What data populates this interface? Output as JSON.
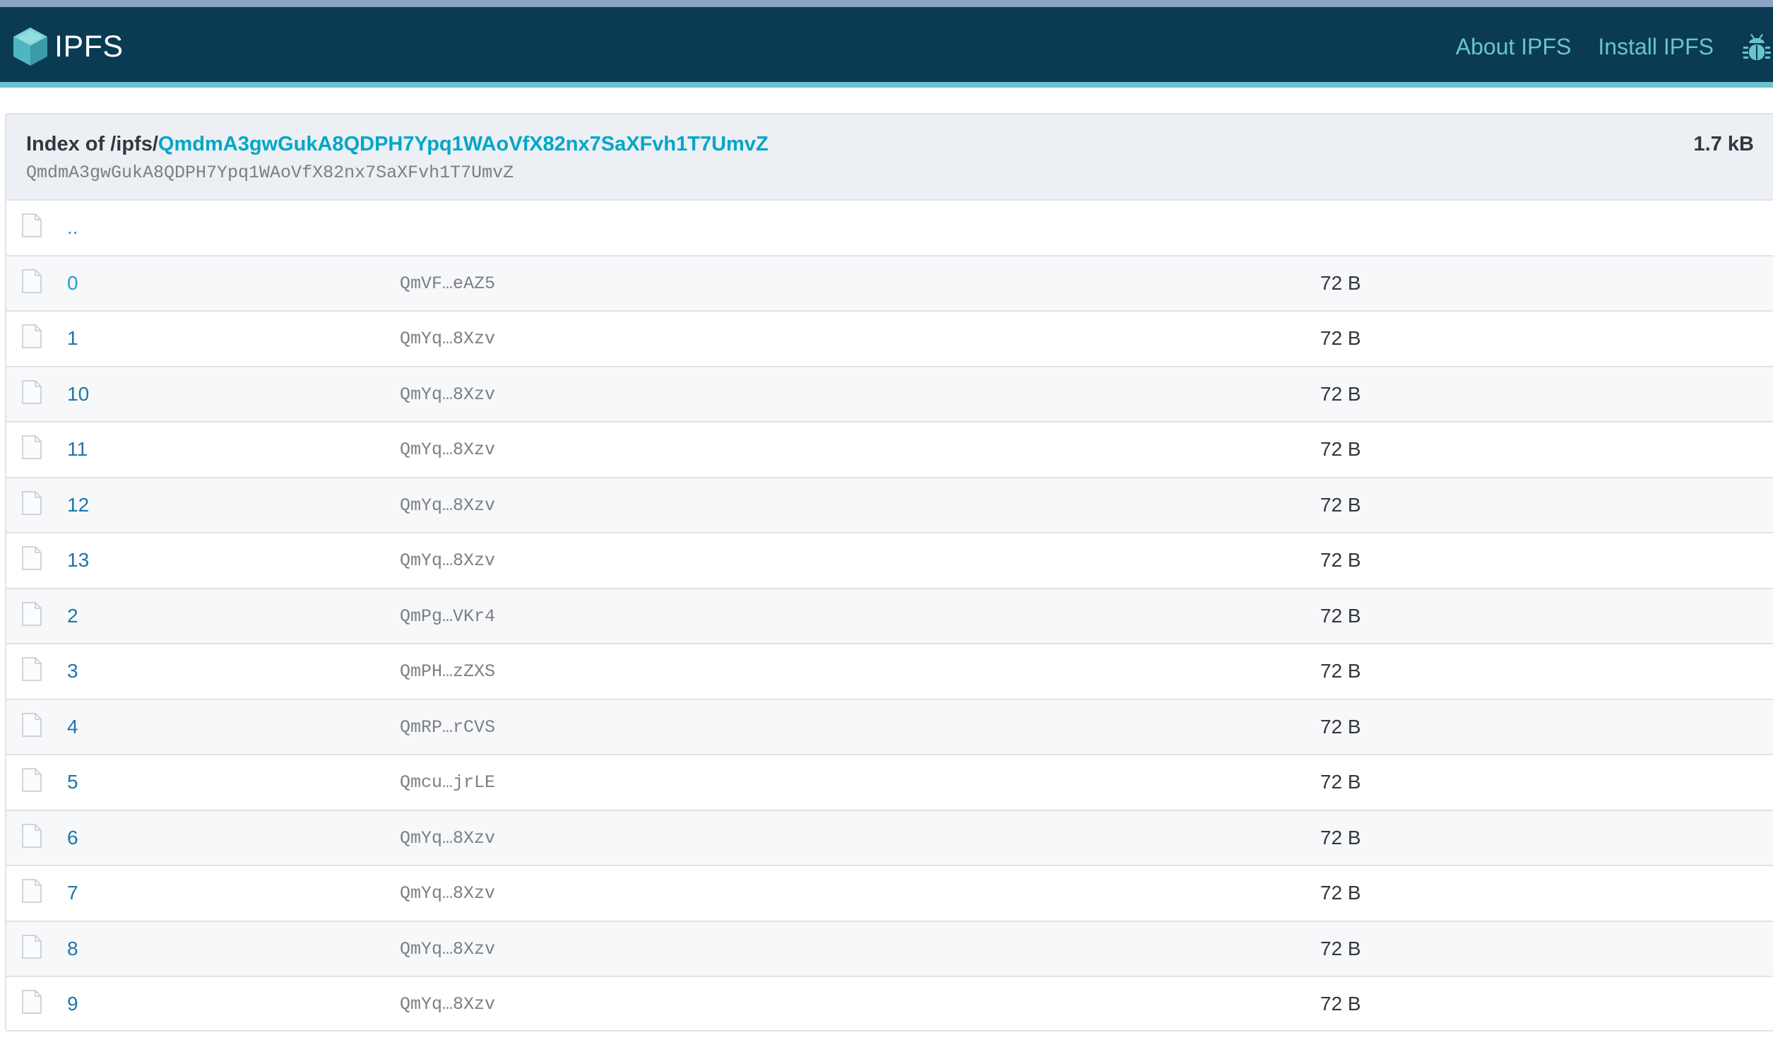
{
  "header": {
    "logo_text": "IPFS",
    "nav": [
      {
        "label": "About IPFS"
      },
      {
        "label": "Install IPFS"
      }
    ],
    "colors": {
      "bar": "#0b3a53",
      "accent": "#69c4cd"
    }
  },
  "listing": {
    "index_prefix": "Index of /ipfs/",
    "cid": "QmdmA3gwGukA8QDPH7Ypq1WAoVfX82nx7SaXFvh1T7UmvZ",
    "cid_sub": "QmdmA3gwGukA8QDPH7Ypq1WAoVfX82nx7SaXFvh1T7UmvZ",
    "total_size": "1.7 kB",
    "rows": [
      {
        "name": "..",
        "hash": "",
        "size": ""
      },
      {
        "name": "0",
        "hash": "QmVF…eAZ5",
        "size": "72 B"
      },
      {
        "name": "1",
        "hash": "QmYq…8Xzv",
        "size": "72 B"
      },
      {
        "name": "10",
        "hash": "QmYq…8Xzv",
        "size": "72 B"
      },
      {
        "name": "11",
        "hash": "QmYq…8Xzv",
        "size": "72 B"
      },
      {
        "name": "12",
        "hash": "QmYq…8Xzv",
        "size": "72 B"
      },
      {
        "name": "13",
        "hash": "QmYq…8Xzv",
        "size": "72 B"
      },
      {
        "name": "2",
        "hash": "QmPg…VKr4",
        "size": "72 B"
      },
      {
        "name": "3",
        "hash": "QmPH…zZXS",
        "size": "72 B"
      },
      {
        "name": "4",
        "hash": "QmRP…rCVS",
        "size": "72 B"
      },
      {
        "name": "5",
        "hash": "Qmcu…jrLE",
        "size": "72 B"
      },
      {
        "name": "6",
        "hash": "QmYq…8Xzv",
        "size": "72 B"
      },
      {
        "name": "7",
        "hash": "QmYq…8Xzv",
        "size": "72 B"
      },
      {
        "name": "8",
        "hash": "QmYq…8Xzv",
        "size": "72 B"
      },
      {
        "name": "9",
        "hash": "QmYq…8Xzv",
        "size": "72 B"
      }
    ]
  }
}
